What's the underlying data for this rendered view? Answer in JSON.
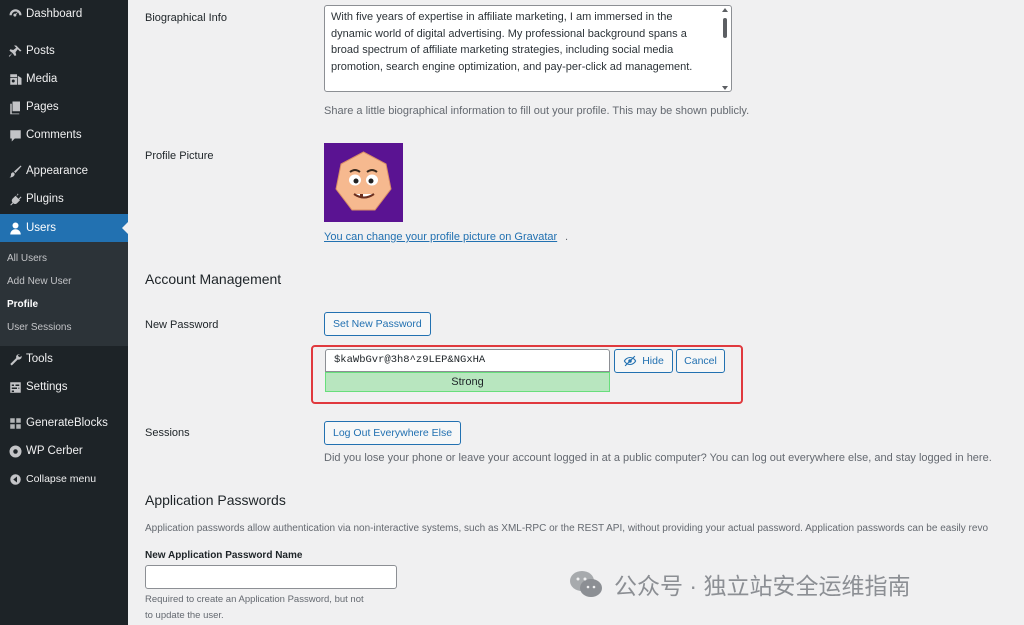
{
  "sidebar": {
    "items": [
      {
        "label": "Dashboard",
        "icon": "dashboard-icon"
      },
      {
        "label": "Posts",
        "icon": "pin-icon"
      },
      {
        "label": "Media",
        "icon": "media-icon"
      },
      {
        "label": "Pages",
        "icon": "pages-icon"
      },
      {
        "label": "Comments",
        "icon": "comment-icon"
      },
      {
        "label": "Appearance",
        "icon": "brush-icon"
      },
      {
        "label": "Plugins",
        "icon": "plug-icon"
      },
      {
        "label": "Users",
        "icon": "user-icon"
      },
      {
        "label": "Tools",
        "icon": "wrench-icon"
      },
      {
        "label": "Settings",
        "icon": "settings-icon"
      },
      {
        "label": "GenerateBlocks",
        "icon": "blocks-icon"
      },
      {
        "label": "WP Cerber",
        "icon": "cerber-icon"
      },
      {
        "label": "Collapse menu",
        "icon": "collapse-icon"
      }
    ],
    "active": "Users",
    "submenu": [
      "All Users",
      "Add New User",
      "Profile",
      "User Sessions"
    ],
    "submenu_current": "Profile"
  },
  "bio": {
    "label": "Biographical Info",
    "text": "With five years of expertise in affiliate marketing, I am immersed in the dynamic world of digital advertising. My professional background spans a broad spectrum of affiliate marketing strategies, including social media promotion, search engine optimization, and pay-per-click ad management.",
    "description": "Share a little biographical information to fill out your profile. This may be shown publicly."
  },
  "profile_picture": {
    "label": "Profile Picture",
    "link": "You can change your profile picture on Gravatar",
    "period": "."
  },
  "account": {
    "title": "Account Management",
    "new_password_label": "New Password",
    "set_password_button": "Set New Password",
    "password_value": "$kaWbGvr@3h8^z9LEP&NGxHA",
    "strength": "Strong",
    "hide_button": "Hide",
    "cancel_button": "Cancel",
    "highlight_color": "#e0393e"
  },
  "sessions": {
    "label": "Sessions",
    "button": "Log Out Everywhere Else",
    "description": "Did you lose your phone or leave your account logged in at a public computer? You can log out everywhere else, and stay logged in here."
  },
  "app_passwords": {
    "title": "Application Passwords",
    "description": "Application passwords allow authentication via non-interactive systems, such as XML-RPC or the REST API, without providing your actual password. Application passwords can be easily revo",
    "name_label": "New Application Password Name",
    "hint_line1": "Required to create an Application Password, but not",
    "hint_line2": "to update the user."
  },
  "watermark": {
    "text": "公众号 · 独立站安全运维指南"
  },
  "colors": {
    "sidebar_bg": "#1d2327",
    "accent": "#2271b1",
    "background": "#f0f0f1",
    "strong_bg": "#b8e6bf"
  }
}
